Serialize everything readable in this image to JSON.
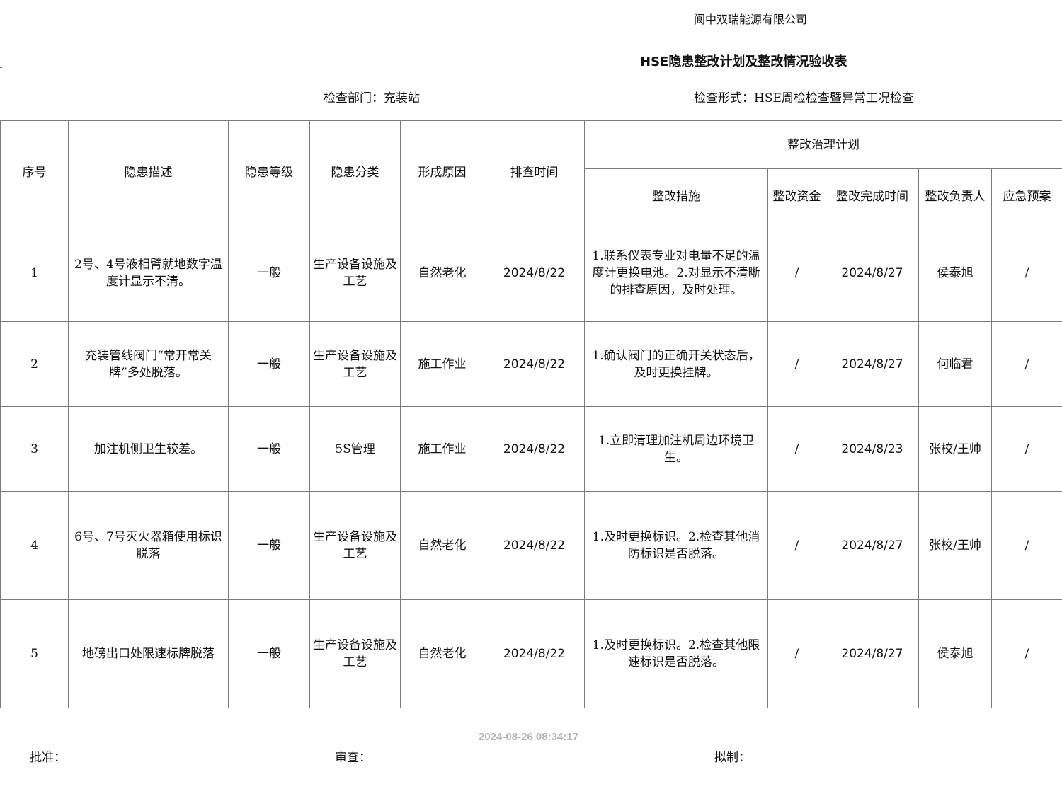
{
  "header": {
    "company": "阆中双瑞能源有限公司",
    "title": "HSE隐患整改计划及整改情况验收表",
    "department": "检查部门：充装站",
    "inspection_form": "检查形式：HSE周检检查暨异常工况检查"
  },
  "table": {
    "columns": {
      "seq": "序号",
      "description": "隐患描述",
      "level": "隐患等级",
      "category": "隐患分类",
      "cause": "形成原因",
      "check_time": "排查时间",
      "plan_group": "整改治理计划",
      "measures": "整改措施",
      "funds": "整改资金",
      "done_time": "整改完成时间",
      "owner": "整改负责人",
      "emergency": "应急预案"
    },
    "rows": [
      {
        "seq": "1",
        "description": "2号、4号液相臂就地数字温度计显示不清。",
        "level": "一般",
        "category": "生产设备设施及工艺",
        "cause": "自然老化",
        "check_time": "2024/8/22",
        "measures": "1.联系仪表专业对电量不足的温度计更换电池。2.对显示不清晰的排查原因，及时处理。",
        "funds": "/",
        "done_time": "2024/8/27",
        "owner": "侯泰旭",
        "emergency": "/"
      },
      {
        "seq": "2",
        "description": "充装管线阀门“常开常关牌”多处脱落。",
        "level": "一般",
        "category": "生产设备设施及工艺",
        "cause": "施工作业",
        "check_time": "2024/8/22",
        "measures": "1.确认阀门的正确开关状态后，及时更换挂牌。",
        "funds": "/",
        "done_time": "2024/8/27",
        "owner": "何临君",
        "emergency": "/"
      },
      {
        "seq": "3",
        "description": "加注机侧卫生较差。",
        "level": "一般",
        "category": "5S管理",
        "cause": "施工作业",
        "check_time": "2024/8/22",
        "measures": "1.立即清理加注机周边环境卫生。",
        "funds": "/",
        "done_time": "2024/8/23",
        "owner": "张校/王帅",
        "emergency": "/"
      },
      {
        "seq": "4",
        "description": "6号、7号灭火器箱使用标识脱落",
        "level": "一般",
        "category": "生产设备设施及工艺",
        "cause": "自然老化",
        "check_time": "2024/8/22",
        "measures": "1.及时更换标识。2.检查其他消防标识是否脱落。",
        "funds": "/",
        "done_time": "2024/8/27",
        "owner": "张校/王帅",
        "emergency": "/"
      },
      {
        "seq": "5",
        "description": "地磅出口处限速标牌脱落",
        "level": "一般",
        "category": "生产设备设施及工艺",
        "cause": "自然老化",
        "check_time": "2024/8/22",
        "measures": "1.及时更换标识。2.检查其他限速标识是否脱落。",
        "funds": "/",
        "done_time": "2024/8/27",
        "owner": "侯泰旭",
        "emergency": "/"
      }
    ]
  },
  "timestamp": "2024-08-26 08:34:17",
  "footer": {
    "approve": "批准：",
    "review": "审查：",
    "prepare": "拟制："
  }
}
